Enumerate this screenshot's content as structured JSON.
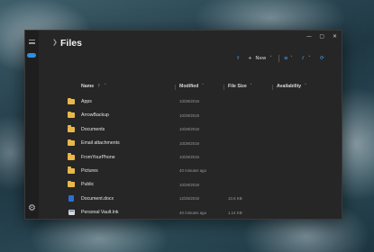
{
  "window": {
    "title": "Files",
    "controls": {
      "minimize": "—",
      "maximize": "▢",
      "close": "✕"
    }
  },
  "rail": {
    "menu_icon": "hamburger-icon",
    "cloud_icon": "cloud-icon",
    "settings_glyph": "⚙"
  },
  "toolbar": {
    "new_label": "New",
    "plus_glyph": "+",
    "caret": "˅",
    "upload_glyph": "⇧",
    "view_glyph": "≡",
    "sort_glyph": "⫽",
    "refresh_glyph": "⟳"
  },
  "columns": {
    "name": "Name",
    "name_sort": "↑",
    "modified": "Modified",
    "size": "File Size",
    "availability": "Availability",
    "caret": "˅"
  },
  "files": [
    {
      "icon": "folder-icon",
      "name": "Apps",
      "modified": "10/29/2019",
      "size": ""
    },
    {
      "icon": "folder-icon",
      "name": "ArrowBackup",
      "modified": "10/29/2019",
      "size": ""
    },
    {
      "icon": "folder-icon",
      "name": "Documents",
      "modified": "10/29/2019",
      "size": ""
    },
    {
      "icon": "folder-icon",
      "name": "Email attachments",
      "modified": "10/29/2019",
      "size": ""
    },
    {
      "icon": "folder-icon",
      "name": "FromYourPhone",
      "modified": "10/29/2019",
      "size": ""
    },
    {
      "icon": "folder-icon",
      "name": "Pictures",
      "modified": "40 minutes ago",
      "size": ""
    },
    {
      "icon": "folder-icon",
      "name": "Public",
      "modified": "10/29/2019",
      "size": ""
    },
    {
      "icon": "word-doc-icon",
      "name": "Document.docx",
      "modified": "12/25/2019",
      "size": "10.6 KB"
    },
    {
      "icon": "shortcut-icon",
      "name": "Personal Vault.lnk",
      "modified": "40 minutes ago",
      "size": "1.14 KB"
    }
  ],
  "colors": {
    "window_bg": "#262626",
    "accent": "#2f8fe0",
    "folder": "#e9b84a"
  }
}
